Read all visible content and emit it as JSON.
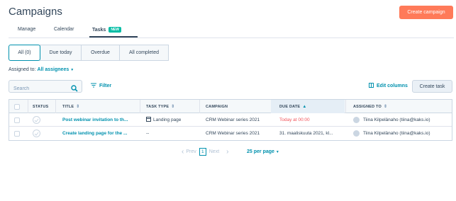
{
  "header": {
    "title": "Campaigns",
    "create_campaign_label": "Create campaign"
  },
  "tabs": [
    {
      "label": "Manage"
    },
    {
      "label": "Calendar"
    },
    {
      "label": "Tasks",
      "badge": "NEW",
      "active": true
    }
  ],
  "views": [
    {
      "label": "All (0)",
      "active": true
    },
    {
      "label": "Due today"
    },
    {
      "label": "Overdue"
    },
    {
      "label": "All completed"
    }
  ],
  "filters": {
    "assigned_label": "Assigned to:",
    "assigned_value": "All assignees",
    "search_placeholder": "Search",
    "filter_label": "Filter",
    "edit_columns_label": "Edit columns",
    "create_task_label": "Create task"
  },
  "table": {
    "columns": [
      "STATUS",
      "TITLE",
      "TASK TYPE",
      "CAMPAIGN",
      "DUE DATE",
      "ASSIGNED TO"
    ],
    "rows": [
      {
        "title": "Post webinar invitation to th...",
        "task_type": "Landing page",
        "campaign": "CRM Webinar series 2021",
        "due_date": "Today at 00:00",
        "assigned_to": "Tiina Kilpelänaho (tiina@kaks.io)"
      },
      {
        "title": "Create landing page for the ...",
        "task_type": "--",
        "campaign": "CRM Webinar series 2021",
        "due_date": "31. maaliskuuta 2021, kl...",
        "assigned_to": "Tiina Kilpelänaho (tiina@kaks.io)"
      }
    ]
  },
  "pagination": {
    "prev_label": "Prev",
    "current_page": "1",
    "next_label": "Next",
    "per_page_label": "25 per page"
  },
  "colors": {
    "accent": "#ff7a59",
    "link": "#0091ae",
    "overdue": "#f2545b",
    "badge": "#00bda5"
  }
}
